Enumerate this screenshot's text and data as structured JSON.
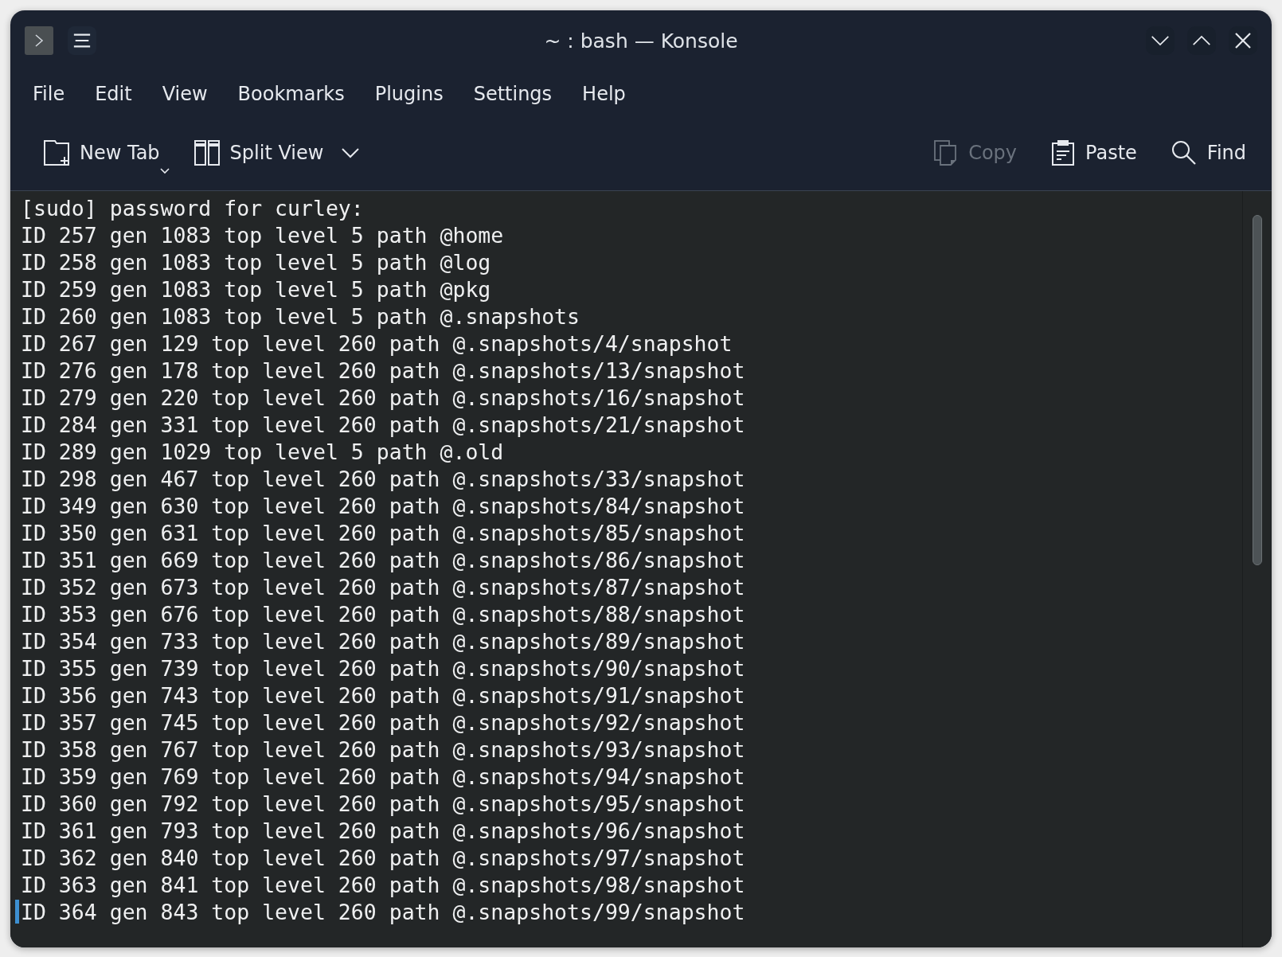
{
  "window": {
    "title": "~ : bash — Konsole"
  },
  "menu": [
    "File",
    "Edit",
    "View",
    "Bookmarks",
    "Plugins",
    "Settings",
    "Help"
  ],
  "toolbar": [
    {
      "kind": "newtab",
      "label": "New Tab",
      "disabled": false
    },
    {
      "kind": "split",
      "label": "Split View",
      "disabled": false
    },
    {
      "kind": "copy",
      "label": "Copy",
      "disabled": true
    },
    {
      "kind": "paste",
      "label": "Paste",
      "disabled": false
    },
    {
      "kind": "find",
      "label": "Find",
      "disabled": false
    }
  ],
  "terminal": {
    "lines": [
      "[sudo] password for curley:",
      "ID 257 gen 1083 top level 5 path @home",
      "ID 258 gen 1083 top level 5 path @log",
      "ID 259 gen 1083 top level 5 path @pkg",
      "ID 260 gen 1083 top level 5 path @.snapshots",
      "ID 267 gen 129 top level 260 path @.snapshots/4/snapshot",
      "ID 276 gen 178 top level 260 path @.snapshots/13/snapshot",
      "ID 279 gen 220 top level 260 path @.snapshots/16/snapshot",
      "ID 284 gen 331 top level 260 path @.snapshots/21/snapshot",
      "ID 289 gen 1029 top level 5 path @.old",
      "ID 298 gen 467 top level 260 path @.snapshots/33/snapshot",
      "ID 349 gen 630 top level 260 path @.snapshots/84/snapshot",
      "ID 350 gen 631 top level 260 path @.snapshots/85/snapshot",
      "ID 351 gen 669 top level 260 path @.snapshots/86/snapshot",
      "ID 352 gen 673 top level 260 path @.snapshots/87/snapshot",
      "ID 353 gen 676 top level 260 path @.snapshots/88/snapshot",
      "ID 354 gen 733 top level 260 path @.snapshots/89/snapshot",
      "ID 355 gen 739 top level 260 path @.snapshots/90/snapshot",
      "ID 356 gen 743 top level 260 path @.snapshots/91/snapshot",
      "ID 357 gen 745 top level 260 path @.snapshots/92/snapshot",
      "ID 358 gen 767 top level 260 path @.snapshots/93/snapshot",
      "ID 359 gen 769 top level 260 path @.snapshots/94/snapshot",
      "ID 360 gen 792 top level 260 path @.snapshots/95/snapshot",
      "ID 361 gen 793 top level 260 path @.snapshots/96/snapshot",
      "ID 362 gen 840 top level 260 path @.snapshots/97/snapshot",
      "ID 363 gen 841 top level 260 path @.snapshots/98/snapshot",
      "ID 364 gen 843 top level 260 path @.snapshots/99/snapshot"
    ]
  }
}
